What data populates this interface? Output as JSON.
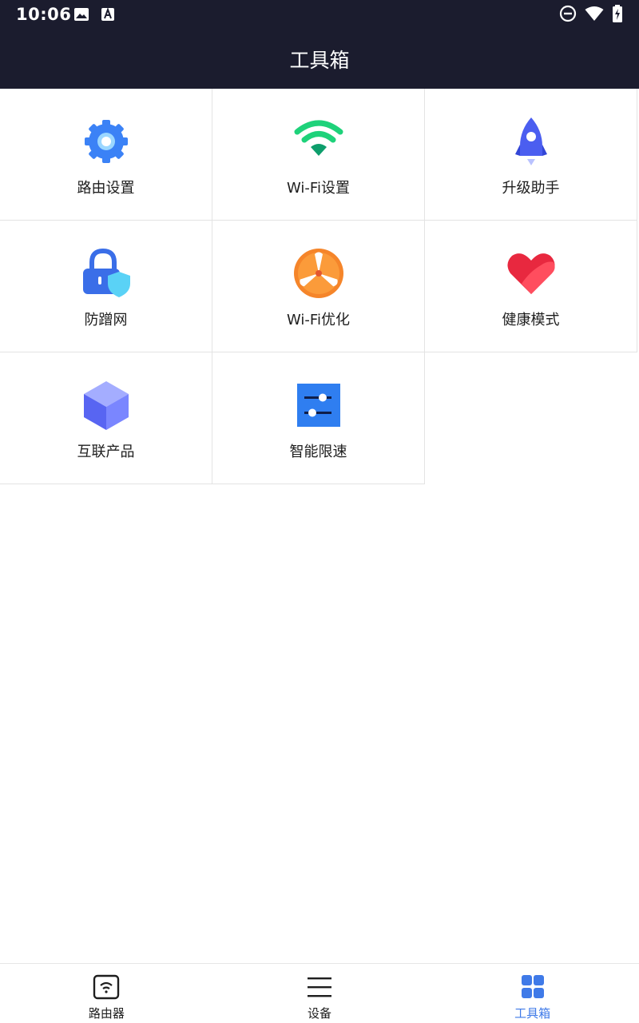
{
  "status_bar": {
    "time": "10:06",
    "left_icons": [
      "image-icon",
      "font-a-icon"
    ],
    "right_icons": [
      "do-not-disturb-icon",
      "wifi-icon",
      "battery-charging-icon"
    ]
  },
  "header": {
    "title": "工具箱"
  },
  "tools": [
    {
      "label": "路由设置",
      "icon": "gear-icon"
    },
    {
      "label": "Wi-Fi设置",
      "icon": "wifi-icon"
    },
    {
      "label": "升级助手",
      "icon": "rocket-icon"
    },
    {
      "label": "防蹭网",
      "icon": "lock-shield-icon"
    },
    {
      "label": "Wi-Fi优化",
      "icon": "fan-icon"
    },
    {
      "label": "健康模式",
      "icon": "heart-icon"
    },
    {
      "label": "互联产品",
      "icon": "cube-icon"
    },
    {
      "label": "智能限速",
      "icon": "sliders-icon"
    }
  ],
  "bottom_nav": [
    {
      "label": "路由器",
      "icon": "router-icon",
      "active": false
    },
    {
      "label": "设备",
      "icon": "list-icon",
      "active": false
    },
    {
      "label": "工具箱",
      "icon": "grid-icon",
      "active": true
    }
  ],
  "colors": {
    "header_bg": "#1b1c2e",
    "accent": "#3f7ae8",
    "gear": "#3b82f6",
    "wifi_green": "#1ed27a",
    "rocket": "#4b5ef0",
    "heart": "#e8283f",
    "fan": "#f5852a"
  }
}
